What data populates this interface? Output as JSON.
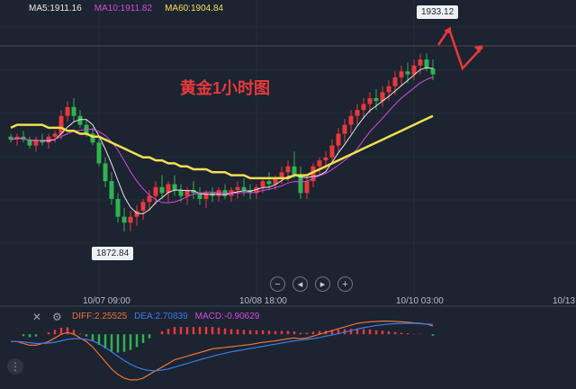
{
  "chart_data": {
    "type": "candlestick",
    "annotation": "黄金1小时图",
    "ma_legend": [
      {
        "label": "MA5:1911.16",
        "color": "#e8e8e8"
      },
      {
        "label": "MA10:1911.82",
        "color": "#d64bd9"
      },
      {
        "label": "MA60:1904.84",
        "color": "#f0e050"
      }
    ],
    "x_ticks": [
      "10/07 09:00",
      "10/08 18:00",
      "10/10 03:00",
      "10/13"
    ],
    "high_label": "1933.12",
    "low_label": "1872.84",
    "price_range": [
      1860,
      1945
    ],
    "candles": [
      [
        1905,
        1906,
        1903,
        1904
      ],
      [
        1904,
        1906,
        1902,
        1905
      ],
      [
        1905,
        1907,
        1903,
        1904
      ],
      [
        1904,
        1905,
        1901,
        1902
      ],
      [
        1902,
        1905,
        1900,
        1904
      ],
      [
        1904,
        1906,
        1902,
        1903
      ],
      [
        1903,
        1906,
        1901,
        1905
      ],
      [
        1905,
        1907,
        1903,
        1906
      ],
      [
        1906,
        1914,
        1904,
        1912
      ],
      [
        1912,
        1917,
        1910,
        1915
      ],
      [
        1915,
        1918,
        1910,
        1912
      ],
      [
        1912,
        1914,
        1908,
        1909
      ],
      [
        1909,
        1911,
        1905,
        1906
      ],
      [
        1906,
        1908,
        1902,
        1903
      ],
      [
        1903,
        1905,
        1895,
        1896
      ],
      [
        1896,
        1898,
        1888,
        1890
      ],
      [
        1890,
        1893,
        1882,
        1884
      ],
      [
        1884,
        1886,
        1876,
        1878
      ],
      [
        1878,
        1881,
        1873,
        1876
      ],
      [
        1876,
        1880,
        1873,
        1878
      ],
      [
        1878,
        1882,
        1875,
        1880
      ],
      [
        1880,
        1884,
        1877,
        1883
      ],
      [
        1883,
        1887,
        1880,
        1885
      ],
      [
        1885,
        1890,
        1882,
        1888
      ],
      [
        1888,
        1892,
        1884,
        1886
      ],
      [
        1886,
        1890,
        1883,
        1889
      ],
      [
        1889,
        1892,
        1885,
        1887
      ],
      [
        1887,
        1889,
        1883,
        1885
      ],
      [
        1885,
        1888,
        1882,
        1887
      ],
      [
        1887,
        1890,
        1884,
        1886
      ],
      [
        1886,
        1888,
        1882,
        1884
      ],
      [
        1884,
        1887,
        1881,
        1886
      ],
      [
        1886,
        1888,
        1883,
        1885
      ],
      [
        1885,
        1888,
        1883,
        1887
      ],
      [
        1887,
        1889,
        1884,
        1885
      ],
      [
        1885,
        1888,
        1883,
        1887
      ],
      [
        1887,
        1890,
        1884,
        1888
      ],
      [
        1888,
        1891,
        1885,
        1887
      ],
      [
        1887,
        1889,
        1884,
        1886
      ],
      [
        1886,
        1889,
        1884,
        1888
      ],
      [
        1888,
        1891,
        1886,
        1890
      ],
      [
        1890,
        1893,
        1887,
        1889
      ],
      [
        1889,
        1892,
        1887,
        1891
      ],
      [
        1891,
        1895,
        1889,
        1893
      ],
      [
        1893,
        1897,
        1890,
        1895
      ],
      [
        1895,
        1900,
        1891,
        1892
      ],
      [
        1892,
        1895,
        1884,
        1886
      ],
      [
        1886,
        1892,
        1884,
        1890
      ],
      [
        1890,
        1896,
        1888,
        1895
      ],
      [
        1895,
        1898,
        1892,
        1897
      ],
      [
        1897,
        1900,
        1894,
        1898
      ],
      [
        1898,
        1904,
        1896,
        1902
      ],
      [
        1902,
        1908,
        1900,
        1906
      ],
      [
        1906,
        1911,
        1903,
        1909
      ],
      [
        1909,
        1914,
        1906,
        1912
      ],
      [
        1912,
        1916,
        1909,
        1914
      ],
      [
        1914,
        1918,
        1911,
        1916
      ],
      [
        1916,
        1920,
        1913,
        1918
      ],
      [
        1918,
        1921,
        1914,
        1917
      ],
      [
        1917,
        1922,
        1915,
        1920
      ],
      [
        1920,
        1924,
        1917,
        1922
      ],
      [
        1922,
        1927,
        1919,
        1925
      ],
      [
        1925,
        1929,
        1922,
        1927
      ],
      [
        1927,
        1930,
        1923,
        1926
      ],
      [
        1926,
        1931,
        1924,
        1929
      ],
      [
        1929,
        1933,
        1926,
        1931
      ],
      [
        1931,
        1933,
        1927,
        1928
      ],
      [
        1928,
        1931,
        1924,
        1926
      ]
    ],
    "ma60": [
      1908,
      1909,
      1909,
      1909,
      1909,
      1909,
      1908,
      1908,
      1908,
      1907,
      1907,
      1906,
      1906,
      1905,
      1905,
      1904,
      1903,
      1902,
      1901,
      1900,
      1899,
      1898,
      1898,
      1897,
      1897,
      1896,
      1896,
      1895,
      1895,
      1894,
      1894,
      1894,
      1893,
      1893,
      1893,
      1892,
      1892,
      1892,
      1891,
      1891,
      1891,
      1891,
      1891,
      1891,
      1891,
      1892,
      1892,
      1892,
      1893,
      1894,
      1895,
      1896,
      1897,
      1898,
      1899,
      1900,
      1901,
      1902,
      1903,
      1904,
      1905,
      1906,
      1907,
      1908,
      1909,
      1910,
      1911,
      1912
    ],
    "macd": {
      "diff_label": "DIFF:2.25525",
      "dea_label": "DEA:2.70839",
      "macd_label": "MACD:-0.90629",
      "diff_color": "#e8743b",
      "dea_color": "#3b7be8",
      "macd_color": "#d64bd9",
      "range": [
        -14,
        4
      ],
      "diff": [
        -2,
        -2,
        -2.5,
        -3,
        -3,
        -2.5,
        -2,
        -1,
        0,
        0.5,
        0,
        -1,
        -2,
        -3.5,
        -5.5,
        -7.5,
        -9.5,
        -11,
        -12,
        -12.5,
        -12.5,
        -12,
        -11,
        -10,
        -9,
        -8,
        -7,
        -6.5,
        -6,
        -5.5,
        -5,
        -4.5,
        -4,
        -3.8,
        -3.6,
        -3.4,
        -3.2,
        -3,
        -2.8,
        -2.5,
        -2.2,
        -2,
        -1.8,
        -1.5,
        -1.2,
        -1,
        -1.2,
        -1,
        -0.5,
        0,
        0.5,
        1,
        1.5,
        2,
        2.5,
        3,
        3.2,
        3.4,
        3.5,
        3.6,
        3.6,
        3.5,
        3.4,
        3.3,
        3.1,
        3,
        2.8,
        2.3
      ],
      "dea": [
        -2,
        -2,
        -2.1,
        -2.3,
        -2.5,
        -2.5,
        -2.4,
        -2.2,
        -1.8,
        -1.4,
        -1.2,
        -1.2,
        -1.4,
        -1.8,
        -2.6,
        -3.6,
        -4.8,
        -6,
        -7.2,
        -8.2,
        -9,
        -9.6,
        -9.9,
        -10,
        -9.8,
        -9.5,
        -9,
        -8.5,
        -8,
        -7.5,
        -7,
        -6.5,
        -6,
        -5.6,
        -5.2,
        -4.8,
        -4.5,
        -4.2,
        -3.9,
        -3.6,
        -3.3,
        -3,
        -2.7,
        -2.4,
        -2.1,
        -1.8,
        -1.6,
        -1.4,
        -1.2,
        -0.9,
        -0.5,
        -0.2,
        0.2,
        0.6,
        1,
        1.4,
        1.8,
        2.1,
        2.4,
        2.6,
        2.8,
        2.9,
        3,
        3,
        3,
        2.9,
        2.8,
        2.7
      ],
      "hist": [
        0,
        0,
        -0.5,
        -0.8,
        -0.6,
        0,
        0.5,
        1.2,
        1.8,
        1.9,
        1.2,
        0.2,
        -0.6,
        -1.7,
        -2.9,
        -3.9,
        -4.7,
        -5,
        -4.8,
        -4.3,
        -3.5,
        -2.4,
        -1.1,
        0,
        0.8,
        1.5,
        2,
        2,
        2,
        2,
        2,
        2,
        2,
        1.8,
        1.6,
        1.4,
        1.3,
        1.2,
        1.1,
        1.1,
        1.1,
        1,
        0.9,
        0.9,
        0.9,
        0.8,
        0.4,
        0.4,
        0.7,
        0.9,
        1,
        1.2,
        1.3,
        1.4,
        1.5,
        1.6,
        1.4,
        1.3,
        1.1,
        1,
        0.8,
        0.6,
        0.4,
        0.3,
        0.1,
        0.1,
        0,
        -0.4
      ]
    }
  },
  "controls": [
    {
      "name": "zoom-out-button",
      "glyph": "−"
    },
    {
      "name": "prev-button",
      "glyph": "◂"
    },
    {
      "name": "next-button",
      "glyph": "▸"
    },
    {
      "name": "zoom-in-button",
      "glyph": "+"
    }
  ],
  "icons": {
    "close": "✕",
    "settings": "⚙",
    "tool": "⋮"
  }
}
